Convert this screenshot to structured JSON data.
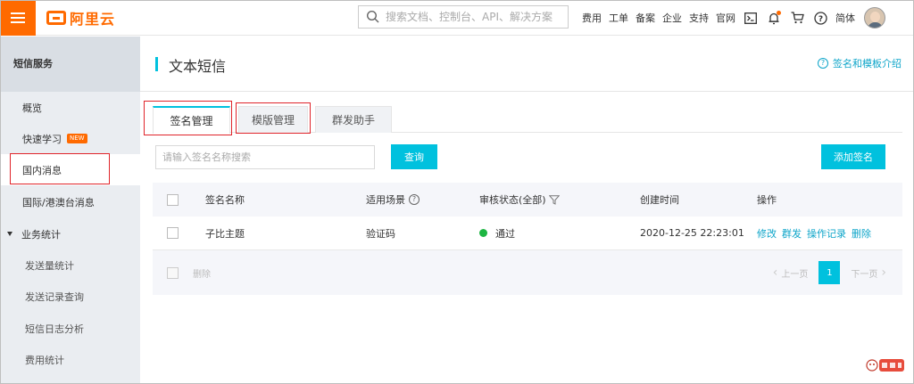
{
  "topbar": {
    "logo_text": "阿里云",
    "search_placeholder": "搜索文档、控制台、API、解决方案",
    "nav": [
      "费用",
      "工单",
      "备案",
      "企业",
      "支持",
      "官网"
    ],
    "lang": "简体",
    "icons": [
      "terminal-icon",
      "bell-icon",
      "cart-icon",
      "help-icon"
    ],
    "brand_color": "#ff6a00"
  },
  "sidebar": {
    "title": "短信服务",
    "items": [
      {
        "label": "概览"
      },
      {
        "label": "快速学习",
        "badge": "NEW"
      },
      {
        "label": "国内消息"
      },
      {
        "label": "国际/港澳台消息"
      },
      {
        "label": "业务统计"
      },
      {
        "label": "发送量统计"
      },
      {
        "label": "发送记录查询"
      },
      {
        "label": "短信日志分析"
      },
      {
        "label": "费用统计"
      }
    ]
  },
  "page": {
    "title": "文本短信",
    "help_link": "签名和模板介绍"
  },
  "tabs": [
    "签名管理",
    "模版管理",
    "群发助手"
  ],
  "toolbar": {
    "search_placeholder": "请输入签名名称搜索",
    "query_button": "查询",
    "add_button": "添加签名"
  },
  "table": {
    "headers": {
      "name": "签名名称",
      "scene": "适用场景",
      "status": "审核状态(全部)",
      "created": "创建时间",
      "actions": "操作"
    },
    "rows": [
      {
        "name": "子比主题",
        "scene": "验证码",
        "status": "通过",
        "created": "2020-12-25 22:23:01",
        "actions": [
          "修改",
          "群发",
          "操作记录",
          "删除"
        ]
      }
    ],
    "footer": {
      "delete": "删除",
      "prev": "上一页",
      "page": "1",
      "next": "下一页"
    }
  },
  "accent_color": "#00c1de",
  "status_color": "#1db542"
}
